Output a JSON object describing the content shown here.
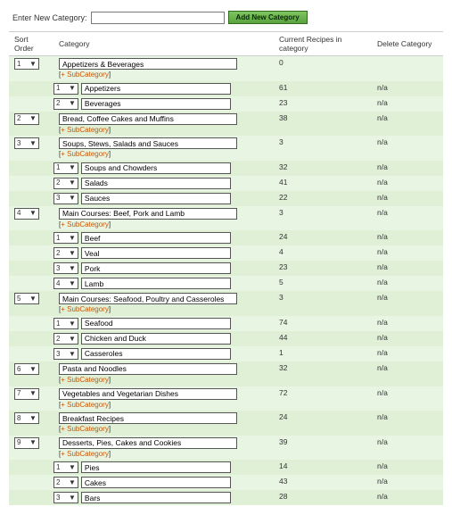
{
  "top": {
    "label": "Enter New Category:",
    "input_value": "",
    "button_label": "Add New Category"
  },
  "headers": {
    "sort": "Sort Order",
    "category": "Category",
    "count": "Current Recipes in category",
    "delete": "Delete Category"
  },
  "addsub_label": "+ SubCategory",
  "categories": [
    {
      "sort": "1",
      "name": "Appetizers & Beverages",
      "count": "0",
      "delete": "",
      "subs": [
        {
          "sort": "1",
          "name": "Appetizers",
          "count": "61",
          "delete": "n/a"
        },
        {
          "sort": "2",
          "name": "Beverages",
          "count": "23",
          "delete": "n/a"
        }
      ]
    },
    {
      "sort": "2",
      "name": "Bread, Coffee Cakes and Muffins",
      "count": "38",
      "delete": "n/a",
      "subs": []
    },
    {
      "sort": "3",
      "name": "Soups, Stews, Salads and Sauces",
      "count": "3",
      "delete": "n/a",
      "subs": [
        {
          "sort": "1",
          "name": "Soups and Chowders",
          "count": "32",
          "delete": "n/a"
        },
        {
          "sort": "2",
          "name": "Salads",
          "count": "41",
          "delete": "n/a"
        },
        {
          "sort": "3",
          "name": "Sauces",
          "count": "22",
          "delete": "n/a"
        }
      ]
    },
    {
      "sort": "4",
      "name": "Main Courses: Beef, Pork and Lamb",
      "count": "3",
      "delete": "n/a",
      "subs": [
        {
          "sort": "1",
          "name": "Beef",
          "count": "24",
          "delete": "n/a"
        },
        {
          "sort": "2",
          "name": "Veal",
          "count": "4",
          "delete": "n/a"
        },
        {
          "sort": "3",
          "name": "Pork",
          "count": "23",
          "delete": "n/a"
        },
        {
          "sort": "4",
          "name": "Lamb",
          "count": "5",
          "delete": "n/a"
        }
      ]
    },
    {
      "sort": "5",
      "name": "Main Courses: Seafood, Poultry and Casseroles",
      "count": "3",
      "delete": "n/a",
      "subs": [
        {
          "sort": "1",
          "name": "Seafood",
          "count": "74",
          "delete": "n/a"
        },
        {
          "sort": "2",
          "name": "Chicken and Duck",
          "count": "44",
          "delete": "n/a"
        },
        {
          "sort": "3",
          "name": "Casseroles",
          "count": "1",
          "delete": "n/a"
        }
      ]
    },
    {
      "sort": "6",
      "name": "Pasta and Noodles",
      "count": "32",
      "delete": "n/a",
      "subs": []
    },
    {
      "sort": "7",
      "name": "Vegetables and Vegetarian Dishes",
      "count": "72",
      "delete": "n/a",
      "subs": []
    },
    {
      "sort": "8",
      "name": "Breakfast Recipes",
      "count": "24",
      "delete": "n/a",
      "subs": []
    },
    {
      "sort": "9",
      "name": "Desserts, Pies, Cakes and Cookies",
      "count": "39",
      "delete": "n/a",
      "subs": [
        {
          "sort": "1",
          "name": "Pies",
          "count": "14",
          "delete": "n/a"
        },
        {
          "sort": "2",
          "name": "Cakes",
          "count": "43",
          "delete": "n/a"
        },
        {
          "sort": "3",
          "name": "Bars",
          "count": "28",
          "delete": "n/a"
        }
      ]
    }
  ]
}
